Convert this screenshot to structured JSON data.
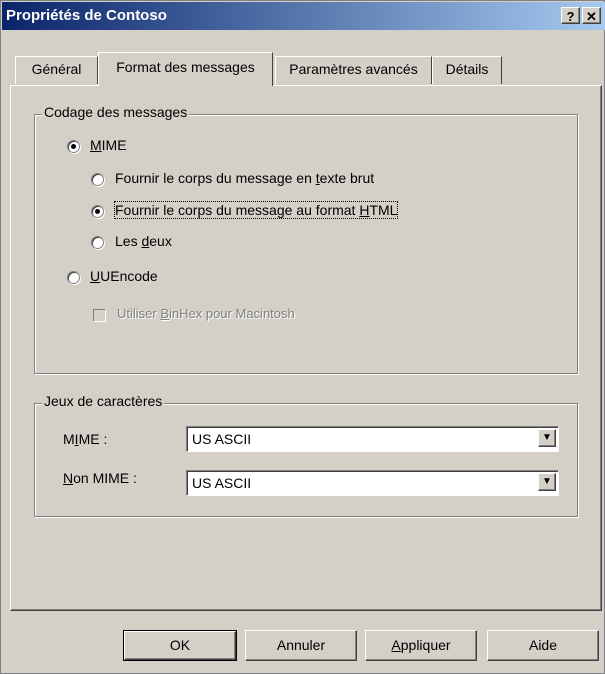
{
  "window": {
    "title": "Propriétés de Contoso"
  },
  "titlebar_buttons": {
    "help": "?",
    "close": "✕"
  },
  "tabs": [
    {
      "label": "Général",
      "active": false
    },
    {
      "label": "Format des messages",
      "active": true
    },
    {
      "label": "Paramètres avancés",
      "active": false
    },
    {
      "label": "Détails",
      "active": false
    }
  ],
  "encoding_group": {
    "legend": "Codage des messages",
    "mime": {
      "mnemonic": "M",
      "rest": "IME",
      "selected": true
    },
    "plain_text": {
      "before": "Fournir le corps du message en ",
      "mnemonic": "t",
      "after": "exte brut",
      "selected": false
    },
    "html": {
      "before": "Fournir le corps du message au format ",
      "mnemonic": "H",
      "after": "TML",
      "selected": true
    },
    "both": {
      "before": "Les ",
      "mnemonic": "d",
      "after": "eux",
      "selected": false
    },
    "uuencode": {
      "mnemonic": "U",
      "rest": "UEncode",
      "selected": false
    },
    "binhex": {
      "before": "Utiliser ",
      "mnemonic": "B",
      "after": "inHex pour Macintosh",
      "checked": false,
      "enabled": false
    }
  },
  "charset_group": {
    "legend": "Jeux de caractères",
    "mime": {
      "label_before": "M",
      "mnemonic": "I",
      "label_after": "ME :",
      "value": "US ASCII"
    },
    "non_mime": {
      "mnemonic": "N",
      "label_after": "on MIME :",
      "value": "US ASCII"
    }
  },
  "buttons": {
    "ok": "OK",
    "cancel": "Annuler",
    "apply": {
      "mnemonic": "A",
      "rest": "ppliquer"
    },
    "help": "Aide"
  },
  "icons": {
    "dropdown": "▼"
  }
}
